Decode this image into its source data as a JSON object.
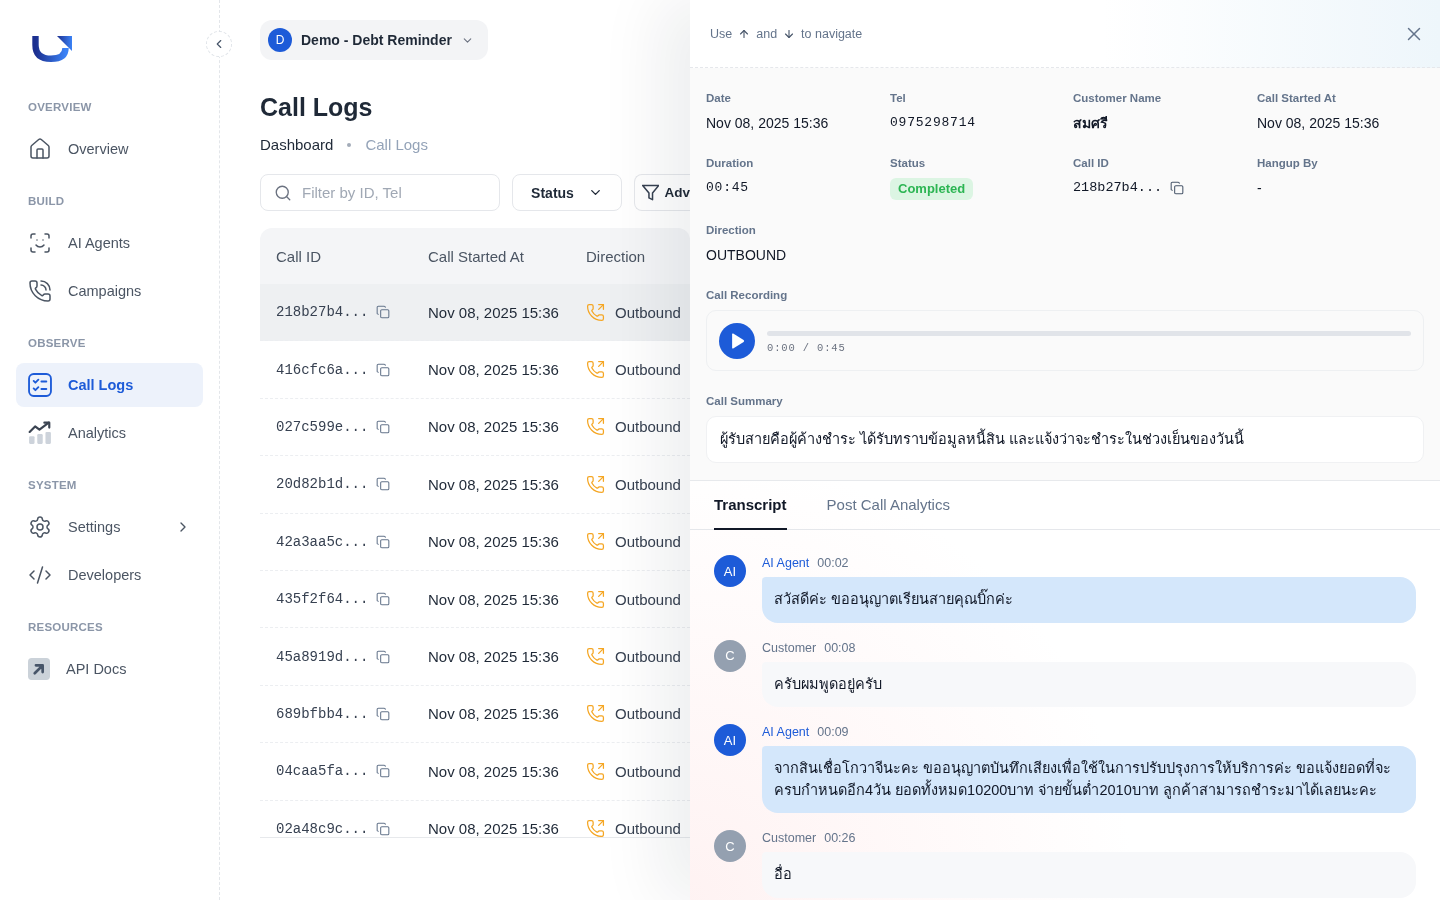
{
  "sidebar": {
    "sections": [
      {
        "title": "OVERVIEW",
        "items": [
          {
            "label": "Overview",
            "selected": false
          }
        ]
      },
      {
        "title": "BUILD",
        "items": [
          {
            "label": "AI Agents",
            "selected": false
          },
          {
            "label": "Campaigns",
            "selected": false
          }
        ]
      },
      {
        "title": "OBSERVE",
        "items": [
          {
            "label": "Call Logs",
            "selected": true
          },
          {
            "label": "Analytics",
            "selected": false
          }
        ]
      },
      {
        "title": "SYSTEM",
        "items": [
          {
            "label": "Settings",
            "selected": false,
            "expanded": false
          },
          {
            "label": "Developers",
            "selected": false
          }
        ]
      },
      {
        "title": "RESOURCES",
        "items": [
          {
            "label": "API Docs",
            "selected": false
          }
        ]
      }
    ]
  },
  "workspace": {
    "initial": "D",
    "name": "Demo - Debt Reminder"
  },
  "page_title": "Call Logs",
  "breadcrumb": [
    "Dashboard",
    "Call Logs"
  ],
  "filters": {
    "search": {
      "placeholder": "Filter by ID, Tel"
    },
    "buttons": [
      {
        "kind": "dropdown",
        "label": "Status"
      },
      {
        "kind": "filter",
        "label": "Adv"
      }
    ]
  },
  "table": {
    "columns": [
      "Call ID",
      "Call Started At",
      "Direction"
    ],
    "rows": [
      {
        "call_id": "218b27b4...",
        "started_at": "Nov 08, 2025 15:36",
        "direction": "Outbound",
        "selected": true
      },
      {
        "call_id": "416cfc6a...",
        "started_at": "Nov 08, 2025 15:36",
        "direction": "Outbound",
        "selected": false
      },
      {
        "call_id": "027c599e...",
        "started_at": "Nov 08, 2025 15:36",
        "direction": "Outbound",
        "selected": false
      },
      {
        "call_id": "20d82b1d...",
        "started_at": "Nov 08, 2025 15:36",
        "direction": "Outbound",
        "selected": false
      },
      {
        "call_id": "42a3aa5c...",
        "started_at": "Nov 08, 2025 15:36",
        "direction": "Outbound",
        "selected": false
      },
      {
        "call_id": "435f2f64...",
        "started_at": "Nov 08, 2025 15:36",
        "direction": "Outbound",
        "selected": false
      },
      {
        "call_id": "45a8919d...",
        "started_at": "Nov 08, 2025 15:36",
        "direction": "Outbound",
        "selected": false
      },
      {
        "call_id": "689bfbb4...",
        "started_at": "Nov 08, 2025 15:36",
        "direction": "Outbound",
        "selected": false
      },
      {
        "call_id": "04caa5fa...",
        "started_at": "Nov 08, 2025 15:36",
        "direction": "Outbound",
        "selected": false
      },
      {
        "call_id": "02a48c9c...",
        "started_at": "Nov 08, 2025 15:36",
        "direction": "Outbound",
        "selected": false
      }
    ]
  },
  "detail_panel": {
    "nav_hint": [
      "Use",
      "and",
      "to navigate"
    ],
    "fields": [
      {
        "label": "Date",
        "value": "Nov 08, 2025 15:36",
        "kind": "text"
      },
      {
        "label": "Tel",
        "value": "0975298714",
        "kind": "mono"
      },
      {
        "label": "Customer Name",
        "value": "สมศรี",
        "kind": "strong"
      },
      {
        "label": "Call Started At",
        "value": "Nov 08, 2025 15:36",
        "kind": "text"
      },
      {
        "label": "Duration",
        "value": "00:45",
        "kind": "mono"
      },
      {
        "label": "Status",
        "value": "Completed",
        "kind": "badge"
      },
      {
        "label": "Call ID",
        "value": "218b27b4...",
        "kind": "copyable"
      },
      {
        "label": "Hangup By",
        "value": "-",
        "kind": "text"
      },
      {
        "label": "Direction",
        "value": "OUTBOUND",
        "kind": "text"
      }
    ],
    "recording": {
      "label": "Call Recording",
      "playing": false,
      "level": 0,
      "time": "0:00 / 0:45"
    },
    "summary": {
      "label": "Call Summary",
      "text": "ผู้รับสายคือผู้ค้างชำระ ได้รับทราบข้อมูลหนี้สิน และแจ้งว่าจะชำระในช่วงเย็นของวันนี้"
    },
    "tabs": [
      {
        "label": "Transcript",
        "selected": true
      },
      {
        "label": "Post Call Analytics",
        "selected": false
      }
    ],
    "transcript": [
      {
        "kind": "agent",
        "avatar": "AI",
        "speaker": "AI Agent",
        "time": "00:02",
        "text": "สวัสดีค่ะ ขออนุญาตเรียนสายคุณบิ๊กค่ะ"
      },
      {
        "kind": "customer",
        "avatar": "C",
        "speaker": "Customer",
        "time": "00:08",
        "text": "ครับผมพูดอยู่ครับ"
      },
      {
        "kind": "agent",
        "avatar": "AI",
        "speaker": "AI Agent",
        "time": "00:09",
        "text": "จากสินเชื่อโกวาจีนะคะ ขออนุญาตบันทึกเสียงเพื่อใช้ในการปรับปรุงการให้บริการค่ะ ขอแจ้งยอดที่จะครบกำหนดอีก4วัน ยอดทั้งหมด10200บาท จ่ายขั้นต่ำ2010บาท ลูกค้าสามารถชำระมาได้เลยนะคะ"
      },
      {
        "kind": "customer",
        "avatar": "C",
        "speaker": "Customer",
        "time": "00:26",
        "text": "อื่อ"
      }
    ]
  }
}
